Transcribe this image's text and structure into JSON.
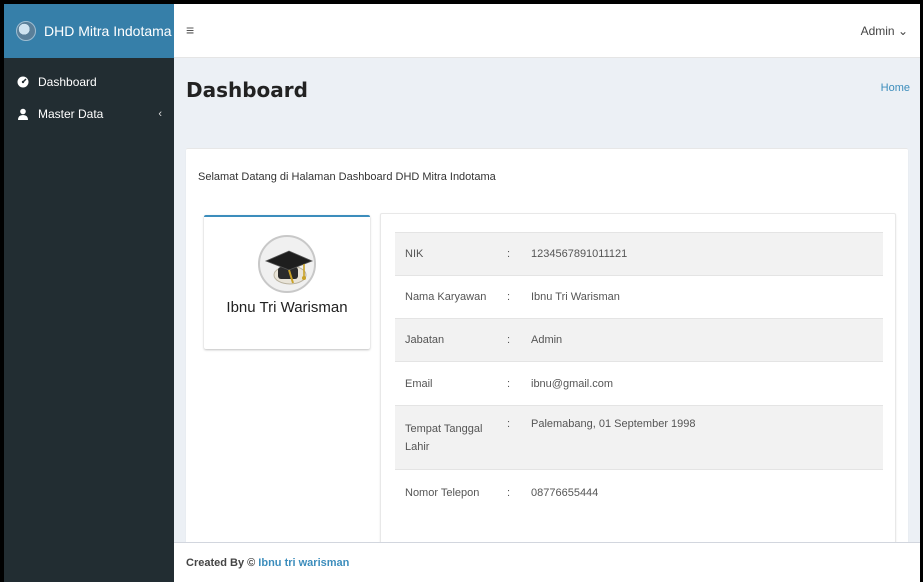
{
  "brand": {
    "name": "DHD Mitra Indotama",
    "logo_icon": "globe-logo"
  },
  "sidebar": {
    "items": [
      {
        "label": "Dashboard",
        "icon": "dashboard-icon"
      },
      {
        "label": "Master Data",
        "icon": "user-icon",
        "chevron": "‹"
      }
    ]
  },
  "header": {
    "menu_toggle": "≡",
    "user": "Admin",
    "user_caret": "⌄"
  },
  "page": {
    "title": "Dashboard",
    "breadcrumb": "Home"
  },
  "welcome_text": "Selamat Datang di Halaman Dashboard DHD Mitra Indotama",
  "profile": {
    "name": "Ibnu Tri Warisman",
    "avatar_icon": "graduation-cap-icon"
  },
  "info": {
    "rows": [
      {
        "label": "NIK",
        "sep": ":",
        "value": "1234567891011121"
      },
      {
        "label": "Nama Karyawan",
        "sep": ":",
        "value": "Ibnu Tri Warisman"
      },
      {
        "label": "Jabatan",
        "sep": ":",
        "value": "Admin"
      },
      {
        "label": "Email",
        "sep": ":",
        "value": "ibnu@gmail.com"
      },
      {
        "label": "Tempat Tanggal Lahir",
        "sep": ":",
        "value": "Palemabang, 01 September 1998"
      },
      {
        "label": "Nomor Telepon",
        "sep": ":",
        "value": "08776655444"
      }
    ]
  },
  "footer": {
    "prefix": "Created By © ",
    "author": "Ibnu tri warisman"
  },
  "colors": {
    "sidebar_bg": "#222d32",
    "brand_bg": "#367fa9",
    "accent": "#3c8dbc",
    "content_bg": "#ecf0f5"
  }
}
